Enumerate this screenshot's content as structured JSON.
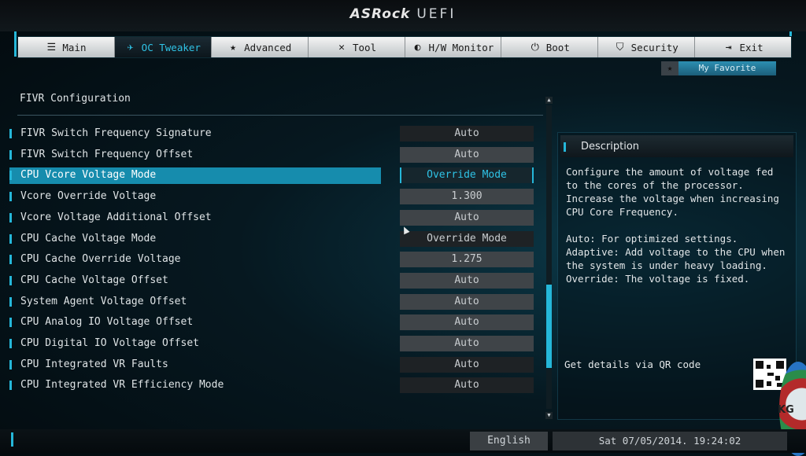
{
  "header": {
    "brand": "ASRock",
    "product": "UEFI"
  },
  "tabs": [
    {
      "label": "Main",
      "icon": "list-icon"
    },
    {
      "label": "OC Tweaker",
      "icon": "rocket-icon"
    },
    {
      "label": "Advanced",
      "icon": "star-icon"
    },
    {
      "label": "Tool",
      "icon": "wrench-icon"
    },
    {
      "label": "H/W Monitor",
      "icon": "monitor-icon"
    },
    {
      "label": "Boot",
      "icon": "power-icon"
    },
    {
      "label": "Security",
      "icon": "shield-icon"
    },
    {
      "label": "Exit",
      "icon": "exit-icon"
    }
  ],
  "active_tab": "OC Tweaker",
  "favorite": {
    "label": "My Favorite",
    "icon": "star-icon"
  },
  "section": {
    "title": "FIVR Configuration"
  },
  "settings": [
    {
      "label": "FIVR Switch Frequency Signature",
      "value": "Auto"
    },
    {
      "label": "FIVR Switch Frequency Offset",
      "value": "Auto"
    },
    {
      "label": "CPU Vcore Voltage Mode",
      "value": "Override Mode"
    },
    {
      "label": "Vcore Override Voltage",
      "value": "1.300"
    },
    {
      "label": "Vcore Voltage Additional Offset",
      "value": "Auto"
    },
    {
      "label": "CPU Cache Voltage Mode",
      "value": "Override Mode"
    },
    {
      "label": "CPU Cache Override Voltage",
      "value": "1.275"
    },
    {
      "label": "CPU Cache Voltage Offset",
      "value": "Auto"
    },
    {
      "label": "System Agent Voltage Offset",
      "value": "Auto"
    },
    {
      "label": "CPU Analog IO Voltage Offset",
      "value": "Auto"
    },
    {
      "label": "CPU Digital IO Voltage Offset",
      "value": "Auto"
    },
    {
      "label": "CPU Integrated VR Faults",
      "value": "Auto"
    },
    {
      "label": "CPU Integrated VR Efficiency Mode",
      "value": "Auto"
    }
  ],
  "selected_setting": "CPU Vcore Voltage Mode",
  "description": {
    "title": "Description",
    "text": "Configure the amount of voltage fed to the cores of the processor. Increase the voltage when increasing CPU Core Frequency.\n\nAuto: For optimized settings.\nAdaptive: Add voltage to the CPU when the system is under heavy loading.\nOverride: The voltage is fixed.",
    "qr_label": "Get details via QR code"
  },
  "status": {
    "language": "English",
    "datetime": "Sat 07/05/2014. 19:24:02"
  },
  "watermark": {
    "text": "KG"
  },
  "colors": {
    "accent": "#25b7d9",
    "selected_row": "#168cad",
    "background": "#061820"
  }
}
